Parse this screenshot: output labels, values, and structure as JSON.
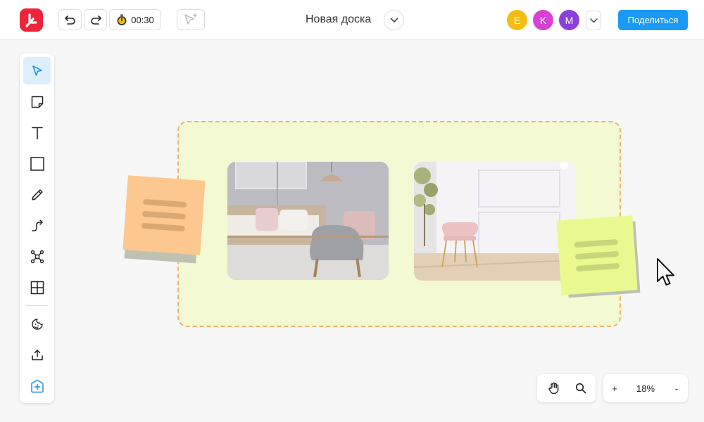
{
  "header": {
    "timer": "00:30",
    "board_title": "Новая доска",
    "share_label": "Поделиться",
    "avatars": [
      {
        "initial": "E",
        "color": "#f4bd10"
      },
      {
        "initial": "K",
        "color": "#d741d6"
      },
      {
        "initial": "M",
        "color": "#8b3fdc"
      }
    ]
  },
  "icons": {
    "logo": "app-logo",
    "undo": "undo-icon",
    "redo": "redo-icon",
    "timer": "stopwatch-icon",
    "presentation": "cursor-follow-icon",
    "chevron": "chevron-down-icon"
  },
  "tools": [
    {
      "name": "select-tool",
      "icon": "pointer-icon",
      "active": true
    },
    {
      "name": "sticky-note-tool",
      "icon": "sticky-note-icon"
    },
    {
      "name": "text-tool",
      "icon": "text-icon"
    },
    {
      "name": "shape-tool",
      "icon": "square-icon"
    },
    {
      "name": "pen-tool",
      "icon": "pencil-icon"
    },
    {
      "name": "connector-tool",
      "icon": "curved-arrow-icon"
    },
    {
      "name": "mind-map-tool",
      "icon": "mind-map-icon"
    },
    {
      "name": "table-tool",
      "icon": "grid-icon"
    },
    {
      "name": "sticker-tool",
      "icon": "sticker-icon"
    },
    {
      "name": "upload-tool",
      "icon": "upload-icon"
    },
    {
      "name": "add-tool",
      "icon": "plus-box-icon"
    }
  ],
  "zoom": {
    "plus_label": "+",
    "value": "18%",
    "minus_label": "-"
  },
  "colors": {
    "brand": "#f0233b",
    "accent": "#1a9af5",
    "frame_fill": "#f3f9d2",
    "frame_border": "#f5b06a",
    "sticky_orange": "#fcc88f",
    "sticky_green": "#eaf98f"
  }
}
